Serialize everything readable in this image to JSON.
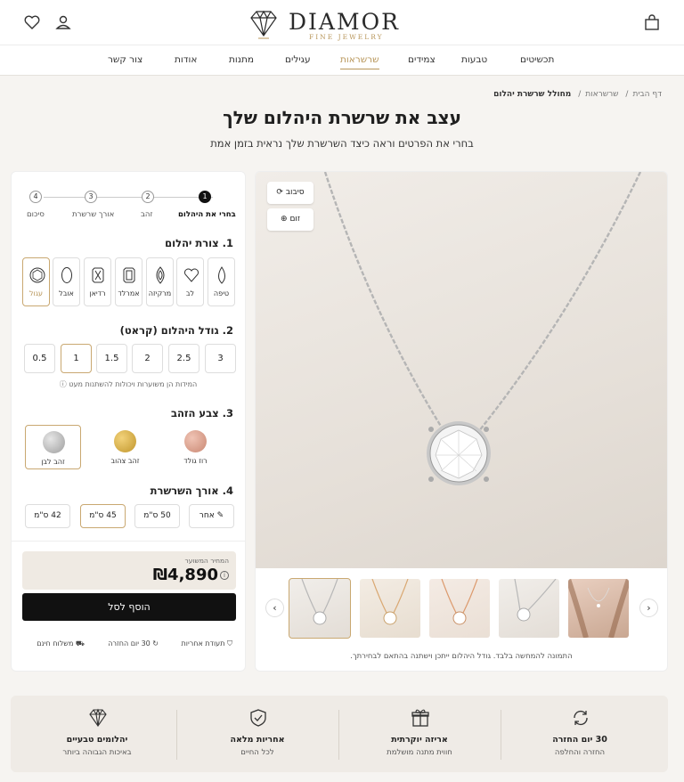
{
  "brand": {
    "name": "DIAMOR",
    "tagline": "FINE JEWELRY"
  },
  "nav": [
    "תכשיטים",
    "טבעות",
    "צמידים",
    "שרשראות",
    "עגילים",
    "מתנות",
    "אודות",
    "צור קשר"
  ],
  "nav_active": "שרשראות",
  "breadcrumb": [
    "דף הבית",
    "שרשראות",
    "מחולל שרשרת יהלום"
  ],
  "page": {
    "title": "עצב את שרשרת היהלום שלך",
    "subtitle": "בחרי את הפרטים וראה כיצד השרשרת שלך נראית בזמן אמת"
  },
  "steps": [
    {
      "num": "1",
      "label": "בחרי את היהלום"
    },
    {
      "num": "2",
      "label": "זהב"
    },
    {
      "num": "3",
      "label": "אורך שרשרת"
    },
    {
      "num": "4",
      "label": "סיכום"
    }
  ],
  "shape": {
    "heading": "1. צורת יהלום",
    "options": [
      "טיפה",
      "לב",
      "מרקיזה",
      "אמרלד",
      "רדיאן",
      "אובל",
      "עגול"
    ],
    "selected": "עגול"
  },
  "size": {
    "heading": "2. גודל היהלום (קראט)",
    "options": [
      "3",
      "2.5",
      "2",
      "1.5",
      "1",
      "0.5"
    ],
    "selected": "1",
    "note": "המידות הן משוערות ויכולות להשתנות מעט"
  },
  "gold": {
    "heading": "3. צבע הזהב",
    "options": [
      {
        "label": "רוז גולד",
        "color": "#d9a28f"
      },
      {
        "label": "זהב צהוב",
        "color": "#d8b24a"
      },
      {
        "label": "זהב לבן",
        "color": "#b9b9b9"
      }
    ],
    "selected": "זהב לבן"
  },
  "length": {
    "heading": "4. אורך השרשרת",
    "options": [
      "אחר",
      "50 ס\"מ",
      "45 ס\"מ",
      "42 ס\"מ"
    ],
    "selected": "45 ס\"מ"
  },
  "price": {
    "label": "המחיר המשוער",
    "value": "₪4,890"
  },
  "cta": {
    "add_to_cart": "הוסף לסל"
  },
  "features": [
    "תעודת אחריות",
    "30 יום החזרה",
    "משלוח חינם"
  ],
  "viewer": {
    "rotate": "סיבוב",
    "zoom": "זום",
    "caption": "התמונה להמחשה בלבד. גודל היהלום ייתכן וישתנה בהתאם לבחירתך."
  },
  "thumbnails": [
    "white-gold",
    "rose-gold",
    "yellow-gold",
    "white-gold",
    "model"
  ],
  "benefits": [
    {
      "title": "30 יום החזרה",
      "sub": "החזרה והחלפה",
      "icon": "return-icon"
    },
    {
      "title": "אריזה יוקרתית",
      "sub": "חווית מתנה מושלמת",
      "icon": "gift-icon"
    },
    {
      "title": "אחריות מלאה",
      "sub": "לכל החיים",
      "icon": "shield-icon"
    },
    {
      "title": "יהלומים טבעיים",
      "sub": "באיכות הגבוהה ביותר",
      "icon": "diamond-icon"
    }
  ],
  "colors": {
    "accent": "#b8965a",
    "dark": "#111111",
    "background": "#f6f4f1"
  }
}
